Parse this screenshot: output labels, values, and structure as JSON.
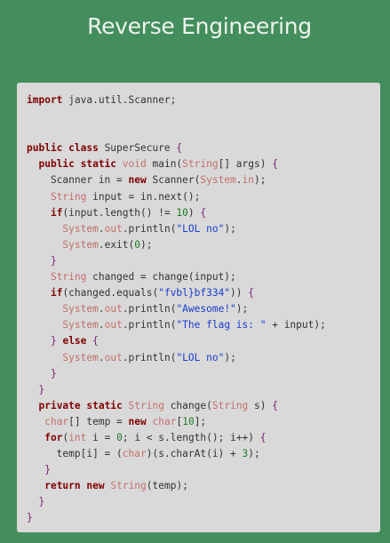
{
  "page": {
    "title": "Reverse Engineering"
  },
  "colors": {
    "background": "#438e5c",
    "card": "#d9d9d9",
    "title": "#eef3ee",
    "keyword": "#800000",
    "type": "#c2706a",
    "string": "#1a3bd0",
    "number": "#1a7a28",
    "brace": "#7a1f74",
    "plain": "#333333"
  },
  "code": {
    "language": "java",
    "lines": [
      [
        [
          "kw",
          "import"
        ],
        [
          "tx",
          " java.util.Scanner;"
        ]
      ],
      [],
      [],
      [
        [
          "kw",
          "public class"
        ],
        [
          "tx",
          " SuperSecure "
        ],
        [
          "br",
          "{"
        ]
      ],
      [
        [
          "tx",
          "  "
        ],
        [
          "kw",
          "public static"
        ],
        [
          "tx",
          " "
        ],
        [
          "ty",
          "void"
        ],
        [
          "tx",
          " main("
        ],
        [
          "ty",
          "String"
        ],
        [
          "tx",
          "[] args) "
        ],
        [
          "br",
          "{"
        ]
      ],
      [
        [
          "tx",
          "    Scanner in = "
        ],
        [
          "kw",
          "new"
        ],
        [
          "tx",
          " Scanner("
        ],
        [
          "sy",
          "System"
        ],
        [
          "tx",
          "."
        ],
        [
          "sy",
          "in"
        ],
        [
          "tx",
          ");"
        ]
      ],
      [
        [
          "tx",
          "    "
        ],
        [
          "ty",
          "String"
        ],
        [
          "tx",
          " input = in.next();"
        ]
      ],
      [
        [
          "tx",
          "    "
        ],
        [
          "kw",
          "if"
        ],
        [
          "tx",
          "(input.length() != "
        ],
        [
          "nm",
          "10"
        ],
        [
          "tx",
          ") "
        ],
        [
          "br",
          "{"
        ]
      ],
      [
        [
          "tx",
          "      "
        ],
        [
          "sy",
          "System"
        ],
        [
          "tx",
          "."
        ],
        [
          "sy",
          "out"
        ],
        [
          "tx",
          ".println("
        ],
        [
          "st",
          "\"LOL no\""
        ],
        [
          "tx",
          ");"
        ]
      ],
      [
        [
          "tx",
          "      "
        ],
        [
          "sy",
          "System"
        ],
        [
          "tx",
          ".exit("
        ],
        [
          "nm",
          "0"
        ],
        [
          "tx",
          ");"
        ]
      ],
      [
        [
          "tx",
          "    "
        ],
        [
          "br",
          "}"
        ]
      ],
      [
        [
          "tx",
          "    "
        ],
        [
          "ty",
          "String"
        ],
        [
          "tx",
          " changed = change(input);"
        ]
      ],
      [
        [
          "tx",
          "    "
        ],
        [
          "kw",
          "if"
        ],
        [
          "tx",
          "(changed.equals("
        ],
        [
          "st",
          "\"fvbl}bf334\""
        ],
        [
          "tx",
          ")) "
        ],
        [
          "br",
          "{"
        ]
      ],
      [
        [
          "tx",
          "      "
        ],
        [
          "sy",
          "System"
        ],
        [
          "tx",
          "."
        ],
        [
          "sy",
          "out"
        ],
        [
          "tx",
          ".println("
        ],
        [
          "st",
          "\"Awesome!\""
        ],
        [
          "tx",
          ");"
        ]
      ],
      [
        [
          "tx",
          "      "
        ],
        [
          "sy",
          "System"
        ],
        [
          "tx",
          "."
        ],
        [
          "sy",
          "out"
        ],
        [
          "tx",
          ".println("
        ],
        [
          "st",
          "\"The flag is: \""
        ],
        [
          "tx",
          " + input);"
        ]
      ],
      [
        [
          "tx",
          "    "
        ],
        [
          "br",
          "}"
        ],
        [
          "tx",
          " "
        ],
        [
          "kw",
          "else"
        ],
        [
          "tx",
          " "
        ],
        [
          "br",
          "{"
        ]
      ],
      [
        [
          "tx",
          "      "
        ],
        [
          "sy",
          "System"
        ],
        [
          "tx",
          "."
        ],
        [
          "sy",
          "out"
        ],
        [
          "tx",
          ".println("
        ],
        [
          "st",
          "\"LOL no\""
        ],
        [
          "tx",
          ");"
        ]
      ],
      [
        [
          "tx",
          "    "
        ],
        [
          "br",
          "}"
        ]
      ],
      [
        [
          "tx",
          "  "
        ],
        [
          "br",
          "}"
        ]
      ],
      [
        [
          "tx",
          "  "
        ],
        [
          "kw",
          "private static"
        ],
        [
          "tx",
          " "
        ],
        [
          "ty",
          "String"
        ],
        [
          "tx",
          " change("
        ],
        [
          "ty",
          "String"
        ],
        [
          "tx",
          " s) "
        ],
        [
          "br",
          "{"
        ]
      ],
      [
        [
          "tx",
          "   "
        ],
        [
          "ty",
          "char"
        ],
        [
          "tx",
          "[] temp = "
        ],
        [
          "kw",
          "new"
        ],
        [
          "tx",
          " "
        ],
        [
          "ty",
          "char"
        ],
        [
          "tx",
          "["
        ],
        [
          "nm",
          "10"
        ],
        [
          "tx",
          "];"
        ]
      ],
      [
        [
          "tx",
          "   "
        ],
        [
          "kw",
          "for"
        ],
        [
          "tx",
          "("
        ],
        [
          "ty",
          "int"
        ],
        [
          "tx",
          " i = "
        ],
        [
          "nm",
          "0"
        ],
        [
          "tx",
          "; i < s.length(); i++) "
        ],
        [
          "br",
          "{"
        ]
      ],
      [
        [
          "tx",
          "     temp[i] = ("
        ],
        [
          "ty",
          "char"
        ],
        [
          "tx",
          ")(s.charAt(i) + "
        ],
        [
          "nm",
          "3"
        ],
        [
          "tx",
          ");"
        ]
      ],
      [
        [
          "tx",
          "   "
        ],
        [
          "br",
          "}"
        ]
      ],
      [
        [
          "tx",
          "   "
        ],
        [
          "kw",
          "return"
        ],
        [
          "tx",
          " "
        ],
        [
          "kw",
          "new"
        ],
        [
          "tx",
          " "
        ],
        [
          "ty",
          "String"
        ],
        [
          "tx",
          "(temp);"
        ]
      ],
      [
        [
          "tx",
          "  "
        ],
        [
          "br",
          "}"
        ]
      ],
      [
        [
          "br",
          "}"
        ]
      ]
    ]
  }
}
